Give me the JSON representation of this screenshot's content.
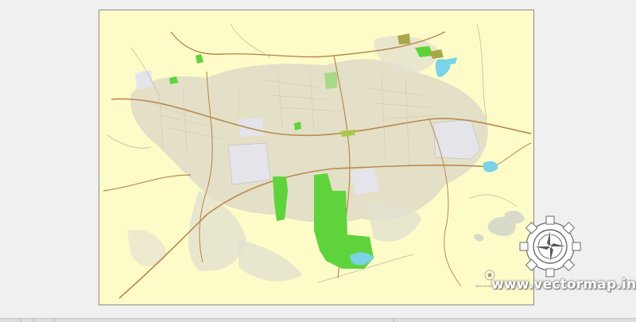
{
  "watermark": {
    "text": "www.vectormap.info",
    "logo_icon": "gear-compass-icon"
  },
  "caption": {
    "small_text": "www.vectormap.info"
  },
  "colors": {
    "background": "#fdfcc9",
    "urban_area": "#dedbc7",
    "park_green": "#5fd33b",
    "water": "#7ad3e6",
    "road_major": "#b98a4e",
    "road_minor": "#c8b99a",
    "industrial": "#e6e6ea"
  }
}
